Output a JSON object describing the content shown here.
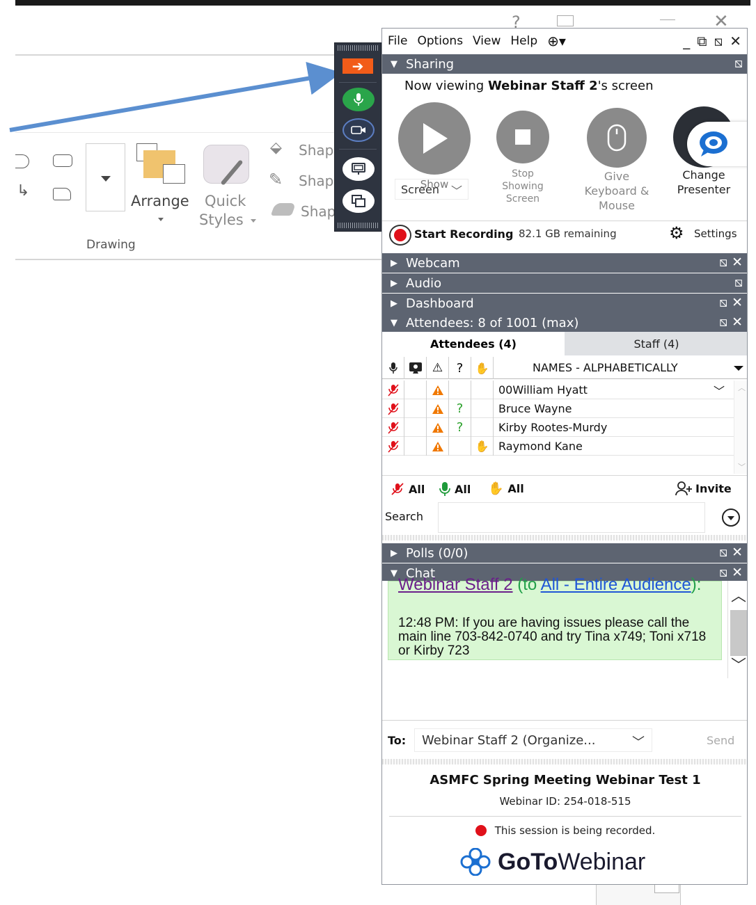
{
  "background_app": {
    "ribbon": {
      "shape_fill_label": "Shap",
      "shape_outline_label": "Shap",
      "shape_effects_label": "Shap",
      "arrange_label": "Arrange",
      "quick_styles_label": "Quick",
      "quick_styles_label2": "Styles",
      "group_label": "Drawing"
    }
  },
  "menu": {
    "items": [
      "File",
      "Options",
      "View",
      "Help"
    ]
  },
  "sharing": {
    "header": "Sharing",
    "now_viewing_prefix": "Now viewing ",
    "now_viewing_name": "Webinar Staff 2",
    "now_viewing_suffix": "'s screen",
    "show_label": "Show",
    "show_dropdown": "Screen",
    "stop_label_1": "Stop",
    "stop_label_2": "Showing",
    "stop_label_3": "Screen",
    "give_label_1": "Give",
    "give_label_2": "Keyboard &",
    "give_label_3": "Mouse",
    "change_label_1": "Change",
    "change_label_2": "Presenter",
    "start_recording": "Start Recording",
    "remaining": "82.1 GB remaining",
    "settings": "Settings"
  },
  "sections": {
    "webcam": "Webcam",
    "audio": "Audio",
    "dashboard": "Dashboard",
    "attendees": "Attendees:  8 of 1001 (max)",
    "polls": "Polls (0/0)",
    "chat": "Chat"
  },
  "attendees": {
    "tab_attendees": "Attendees (4)",
    "tab_staff": "Staff (4)",
    "sort_label": "NAMES - ALPHABETICALLY",
    "rows": [
      {
        "name": "00William Hyatt",
        "question": "",
        "hand": ""
      },
      {
        "name": "Bruce Wayne",
        "question": "?",
        "hand": ""
      },
      {
        "name": "Kirby Rootes-Murdy",
        "question": "?",
        "hand": ""
      },
      {
        "name": "Raymond Kane",
        "question": "",
        "hand": "hand"
      }
    ],
    "mute_all": "All",
    "unmute_all": "All",
    "lower_hands_all": "All",
    "invite": "Invite",
    "search_label": "Search",
    "search_value": ""
  },
  "chat": {
    "sender": "Webinar Staff 2",
    "to_prefix": " (to ",
    "recipient": "All - Entire Audience",
    "to_suffix": "):",
    "message": "12:48 PM: If you are having issues please call the main line 703-842-0740 and try Tina x749; Toni x718 or Kirby 723",
    "to_label": "To:",
    "to_value": "Webinar  Staff  2  (Organize...",
    "send_label": "Send"
  },
  "footer": {
    "title": "ASMFC Spring Meeting Webinar Test 1",
    "webinar_id": "Webinar ID: 254-018-515",
    "recording_notice": "This session is being recorded.",
    "brand_goto": "GoTo",
    "brand_webinar": "Webinar"
  },
  "colors": {
    "header_bg": "#5d6471",
    "strip_bg": "#2e3440",
    "record_red": "#e0101a",
    "warning_orange": "#f07800",
    "question_green": "#2aa02a",
    "chat_bg": "#d9f7d3",
    "link_blue": "#1f56d6",
    "sender_purple": "#6b1f8a"
  }
}
